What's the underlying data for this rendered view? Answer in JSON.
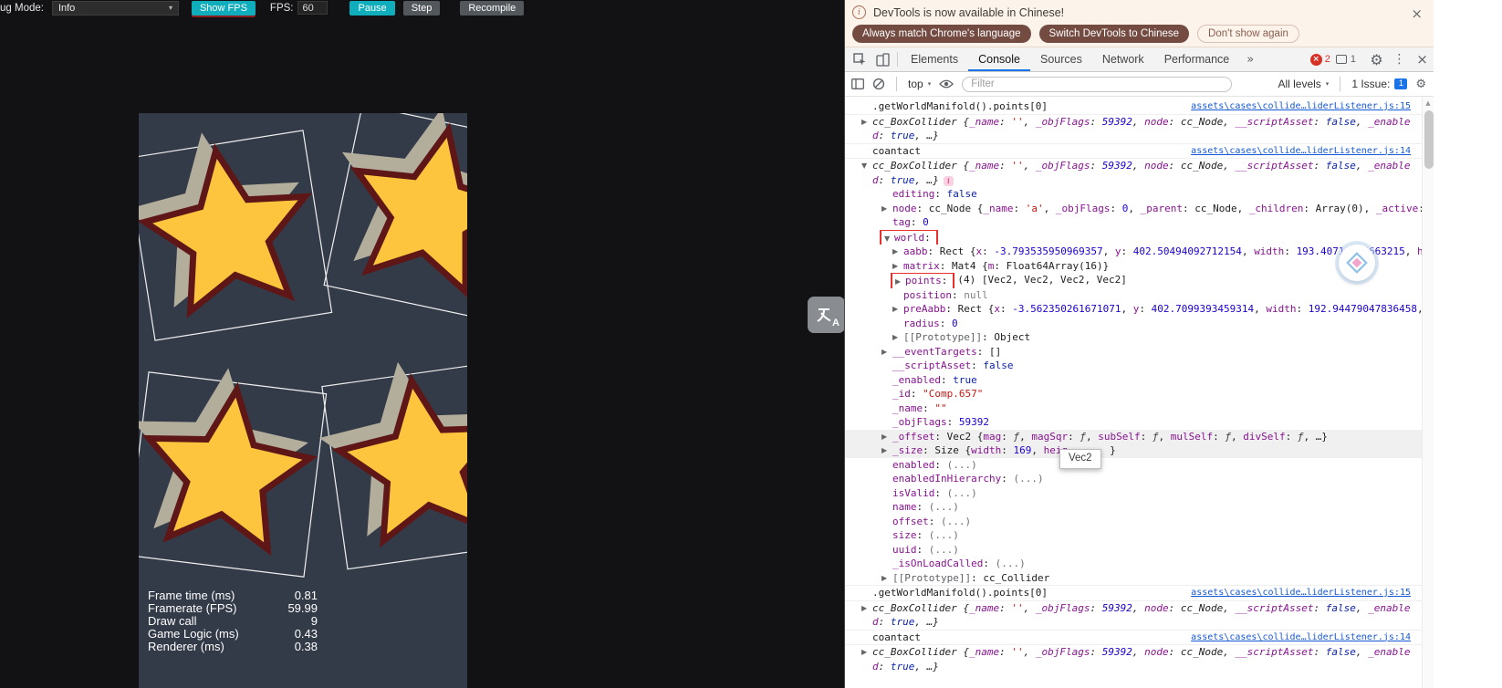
{
  "toolbar": {
    "debug_mode_label": "ug Mode:",
    "debug_mode_value": "Info",
    "show_fps": "Show FPS",
    "fps_label": "FPS:",
    "fps_value": "60",
    "pause": "Pause",
    "step": "Step",
    "recompile": "Recompile"
  },
  "game": {
    "stats": [
      {
        "label": "Frame time (ms)",
        "value": "0.81"
      },
      {
        "label": "Framerate (FPS)",
        "value": "59.99"
      },
      {
        "label": "Draw call",
        "value": "9"
      },
      {
        "label": "Game Logic (ms)",
        "value": "0.43"
      },
      {
        "label": "Renderer (ms)",
        "value": "0.38"
      }
    ]
  },
  "translate_button": {
    "label": "A"
  },
  "icons": {
    "more_tabs": "»",
    "gear": "⚙",
    "kebab": "⋮",
    "close": "×",
    "caret_down": "▾",
    "scroll_up": "▲",
    "info": "i",
    "error_x": "×"
  },
  "colors": {
    "accent_teal": "#10aebd",
    "annotation_red": "#e8302e",
    "star_yellow": "#fcc53d",
    "star_outline": "#5e1616",
    "star_shadow": "#b3ad9c",
    "canvas_bg": "#343b48",
    "devtools_accent_blue": "#1a73e8",
    "error_red": "#d93025"
  },
  "devtools": {
    "infobar": {
      "message": "DevTools is now available in Chinese!",
      "buttons": [
        "Always match Chrome's language",
        "Switch DevTools to Chinese",
        "Don't show again"
      ]
    },
    "tabs": [
      "Elements",
      "Console",
      "Sources",
      "Network",
      "Performance"
    ],
    "badges": {
      "errors": "2",
      "messages": "1"
    },
    "toolbar": {
      "context": "top",
      "filter_placeholder": "Filter",
      "levels": "All levels",
      "issues_label": "1 Issue:",
      "issues_count": "1"
    },
    "console": {
      "tooltip": "Vec2",
      "preview_segs": [
        [
          "p",
          "cc_BoxCollider "
        ],
        [
          "p",
          "{"
        ],
        [
          "k",
          "_name"
        ],
        [
          "p",
          ": "
        ],
        [
          "s",
          "''"
        ],
        [
          "p",
          ", "
        ],
        [
          "k",
          "_objFlags"
        ],
        [
          "p",
          ": "
        ],
        [
          "n",
          "59392"
        ],
        [
          "p",
          ", "
        ],
        [
          "k",
          "node"
        ],
        [
          "p",
          ": "
        ],
        [
          "p",
          "cc_Node"
        ],
        [
          "p",
          ", "
        ],
        [
          "k",
          "__scriptAsset"
        ],
        [
          "p",
          ": "
        ],
        [
          "b",
          "false"
        ],
        [
          "p",
          ", "
        ],
        [
          "k",
          "_enabled"
        ],
        [
          "p",
          ": "
        ],
        [
          "b",
          "true"
        ],
        [
          "p",
          ", …}"
        ]
      ],
      "entries": [
        {
          "top": 1,
          "link": "assets\\cases\\collide…liderListener.js:15",
          "segs": [
            [
              "p",
              ".getWorldManifold().points[0]"
            ]
          ]
        },
        {
          "top": 1,
          "arrow": "▶",
          "it": 1,
          "wrap": 1,
          "preview": 1
        },
        {
          "top": 1,
          "link": "assets\\cases\\collide…liderListener.js:14",
          "segs": [
            [
              "p",
              "coantact"
            ]
          ]
        },
        {
          "top": 1,
          "arrow": "▼",
          "it": 1,
          "wrap": 1,
          "icon": 1,
          "preview": 1
        },
        {
          "ind": 1,
          "segs": [
            [
              "k",
              "editing"
            ],
            [
              "p",
              ": "
            ],
            [
              "b",
              "false"
            ]
          ]
        },
        {
          "ind": 1,
          "arrow": "▶",
          "segs": [
            [
              "k",
              "node"
            ],
            [
              "p",
              ": "
            ],
            [
              "p",
              "cc_Node "
            ],
            [
              "p",
              "{"
            ],
            [
              "k",
              "_name"
            ],
            [
              "p",
              ": "
            ],
            [
              "s",
              "'a'"
            ],
            [
              "p",
              ", "
            ],
            [
              "k",
              "_objFlags"
            ],
            [
              "p",
              ": "
            ],
            [
              "n",
              "0"
            ],
            [
              "p",
              ", "
            ],
            [
              "k",
              "_parent"
            ],
            [
              "p",
              ": "
            ],
            [
              "p",
              "cc_Node"
            ],
            [
              "p",
              ", "
            ],
            [
              "k",
              "_children"
            ],
            [
              "p",
              ": "
            ],
            [
              "p",
              "Array(0)"
            ],
            [
              "p",
              ", "
            ],
            [
              "k",
              "_active"
            ],
            [
              "p",
              ":"
            ]
          ]
        },
        {
          "ind": 1,
          "segs": [
            [
              "k",
              "tag"
            ],
            [
              "p",
              ": "
            ],
            [
              "n",
              "0"
            ]
          ]
        },
        {
          "ind": 1,
          "arrow": "▼",
          "box": 2,
          "segs": [
            [
              "k",
              "world"
            ],
            [
              "p",
              ":"
            ]
          ]
        },
        {
          "ind": 2,
          "arrow": "▶",
          "segs": [
            [
              "k",
              "aabb"
            ],
            [
              "p",
              ": "
            ],
            [
              "p",
              "Rect "
            ],
            [
              "p",
              "{"
            ],
            [
              "k",
              "x"
            ],
            [
              "p",
              ": "
            ],
            [
              "n",
              "-3.793535950969357"
            ],
            [
              "p",
              ", "
            ],
            [
              "k",
              "y"
            ],
            [
              "p",
              ": "
            ],
            [
              "n",
              "402.50494092712154"
            ],
            [
              "p",
              ", "
            ],
            [
              "k",
              "width"
            ],
            [
              "p",
              ": "
            ],
            [
              "n",
              "193.40716185663215"
            ],
            [
              "p",
              ", "
            ],
            [
              "k",
              "h"
            ]
          ]
        },
        {
          "ind": 2,
          "arrow": "▶",
          "segs": [
            [
              "k",
              "matrix"
            ],
            [
              "p",
              ": "
            ],
            [
              "p",
              "Mat4 "
            ],
            [
              "p",
              "{"
            ],
            [
              "k",
              "m"
            ],
            [
              "p",
              ": "
            ],
            [
              "p",
              "Float64Array(16)"
            ],
            [
              "p",
              "}"
            ]
          ]
        },
        {
          "ind": 2,
          "arrow": "▶",
          "box": 2,
          "segs": [
            [
              "k",
              "points"
            ],
            [
              "p",
              ": "
            ],
            [
              "p",
              "(4) "
            ],
            [
              "p",
              "[Vec2, Vec2, Vec2, Vec2]"
            ]
          ]
        },
        {
          "ind": 2,
          "segs": [
            [
              "k",
              "position"
            ],
            [
              "p",
              ": "
            ],
            [
              "u",
              "null"
            ]
          ]
        },
        {
          "ind": 2,
          "arrow": "▶",
          "segs": [
            [
              "k",
              "preAabb"
            ],
            [
              "p",
              ": "
            ],
            [
              "p",
              "Rect "
            ],
            [
              "p",
              "{"
            ],
            [
              "k",
              "x"
            ],
            [
              "p",
              ": "
            ],
            [
              "n",
              "-3.562350261671071"
            ],
            [
              "p",
              ", "
            ],
            [
              "k",
              "y"
            ],
            [
              "p",
              ": "
            ],
            [
              "n",
              "402.7099393459314"
            ],
            [
              "p",
              ", "
            ],
            [
              "k",
              "width"
            ],
            [
              "p",
              ": "
            ],
            [
              "n",
              "192.94479047836458"
            ],
            [
              "p",
              ","
            ]
          ]
        },
        {
          "ind": 2,
          "segs": [
            [
              "k",
              "radius"
            ],
            [
              "p",
              ": "
            ],
            [
              "n",
              "0"
            ]
          ]
        },
        {
          "ind": 2,
          "arrow": "▶",
          "segs": [
            [
              "kd",
              "[[Prototype]]"
            ],
            [
              "p",
              ": "
            ],
            [
              "p",
              "Object"
            ]
          ]
        },
        {
          "ind": 1,
          "arrow": "▶",
          "segs": [
            [
              "k",
              "__eventTargets"
            ],
            [
              "p",
              ": "
            ],
            [
              "p",
              "[]"
            ]
          ]
        },
        {
          "ind": 1,
          "segs": [
            [
              "k",
              "__scriptAsset"
            ],
            [
              "p",
              ": "
            ],
            [
              "b",
              "false"
            ]
          ]
        },
        {
          "ind": 1,
          "segs": [
            [
              "k",
              "_enabled"
            ],
            [
              "p",
              ": "
            ],
            [
              "b",
              "true"
            ]
          ]
        },
        {
          "ind": 1,
          "segs": [
            [
              "k",
              "_id"
            ],
            [
              "p",
              ": "
            ],
            [
              "s",
              "\"Comp.657\""
            ]
          ]
        },
        {
          "ind": 1,
          "segs": [
            [
              "k",
              "_name"
            ],
            [
              "p",
              ": "
            ],
            [
              "s",
              "\"\""
            ]
          ]
        },
        {
          "ind": 1,
          "segs": [
            [
              "k",
              "_objFlags"
            ],
            [
              "p",
              ": "
            ],
            [
              "n",
              "59392"
            ]
          ]
        },
        {
          "ind": 1,
          "arrow": "▶",
          "hl": 1,
          "segs": [
            [
              "k",
              "_offset"
            ],
            [
              "p",
              ": "
            ],
            [
              "p",
              "Vec2 "
            ],
            [
              "p",
              "{"
            ],
            [
              "k",
              "mag"
            ],
            [
              "p",
              ": "
            ],
            [
              "f",
              "ƒ"
            ],
            [
              "p",
              ", "
            ],
            [
              "k",
              "magSqr"
            ],
            [
              "p",
              ": "
            ],
            [
              "f",
              "ƒ"
            ],
            [
              "p",
              ", "
            ],
            [
              "k",
              "subSelf"
            ],
            [
              "p",
              ": "
            ],
            [
              "f",
              "ƒ"
            ],
            [
              "p",
              ", "
            ],
            [
              "k",
              "mulSelf"
            ],
            [
              "p",
              ": "
            ],
            [
              "f",
              "ƒ"
            ],
            [
              "p",
              ", "
            ],
            [
              "k",
              "divSelf"
            ],
            [
              "p",
              ": "
            ],
            [
              "f",
              "ƒ"
            ],
            [
              "p",
              ", …}"
            ]
          ]
        },
        {
          "ind": 1,
          "arrow": "▶",
          "hl": 1,
          "tipAfter": 1,
          "segs": [
            [
              "k",
              "_size"
            ],
            [
              "p",
              ": "
            ],
            [
              "p",
              "Size "
            ],
            [
              "p",
              "{"
            ],
            [
              "k",
              "width"
            ],
            [
              "p",
              ": "
            ],
            [
              "n",
              "169"
            ],
            [
              "p",
              ", "
            ],
            [
              "k",
              "heig"
            ],
            [
              "gap",
              ""
            ],
            [
              "p",
              "}"
            ]
          ]
        },
        {
          "ind": 1,
          "segs": [
            [
              "k",
              "enabled"
            ],
            [
              "p",
              ": "
            ],
            [
              "d",
              "(...)"
            ]
          ]
        },
        {
          "ind": 1,
          "segs": [
            [
              "k",
              "enabledInHierarchy"
            ],
            [
              "p",
              ": "
            ],
            [
              "d",
              "(...)"
            ]
          ]
        },
        {
          "ind": 1,
          "segs": [
            [
              "k",
              "isValid"
            ],
            [
              "p",
              ": "
            ],
            [
              "d",
              "(...)"
            ]
          ]
        },
        {
          "ind": 1,
          "segs": [
            [
              "k",
              "name"
            ],
            [
              "p",
              ": "
            ],
            [
              "d",
              "(...)"
            ]
          ]
        },
        {
          "ind": 1,
          "segs": [
            [
              "k",
              "offset"
            ],
            [
              "p",
              ": "
            ],
            [
              "d",
              "(...)"
            ]
          ]
        },
        {
          "ind": 1,
          "segs": [
            [
              "k",
              "size"
            ],
            [
              "p",
              ": "
            ],
            [
              "d",
              "(...)"
            ]
          ]
        },
        {
          "ind": 1,
          "segs": [
            [
              "k",
              "uuid"
            ],
            [
              "p",
              ": "
            ],
            [
              "d",
              "(...)"
            ]
          ]
        },
        {
          "ind": 1,
          "segs": [
            [
              "k",
              "_isOnLoadCalled"
            ],
            [
              "p",
              ": "
            ],
            [
              "d",
              "(...)"
            ]
          ]
        },
        {
          "ind": 1,
          "arrow": "▶",
          "segs": [
            [
              "kd",
              "[[Prototype]]"
            ],
            [
              "p",
              ": "
            ],
            [
              "p",
              "cc_Collider"
            ]
          ]
        },
        {
          "top": 1,
          "link": "assets\\cases\\collide…liderListener.js:15",
          "segs": [
            [
              "p",
              ".getWorldManifold().points[0]"
            ]
          ]
        },
        {
          "top": 1,
          "arrow": "▶",
          "it": 1,
          "wrap": 1,
          "preview": 1
        },
        {
          "top": 1,
          "link": "assets\\cases\\collide…liderListener.js:14",
          "segs": [
            [
              "p",
              "coantact"
            ]
          ]
        },
        {
          "top": 1,
          "arrow": "▶",
          "it": 1,
          "wrap": 1,
          "preview": 1
        }
      ]
    }
  }
}
